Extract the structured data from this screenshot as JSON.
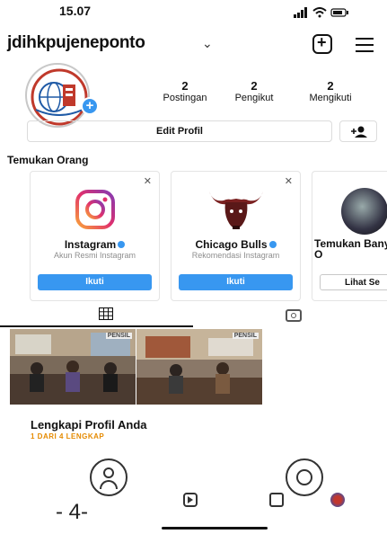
{
  "status_bar": {
    "time": "15.07"
  },
  "header": {
    "username": "jdihkpujeneponto",
    "chevron": "⌄"
  },
  "stats": [
    {
      "value": "2",
      "label": "Postingan"
    },
    {
      "value": "2",
      "label": "Pengikut"
    },
    {
      "value": "2",
      "label": "Mengikuti"
    }
  ],
  "edit_profile_label": "Edit Profil",
  "discover": {
    "title": "Temukan Orang",
    "cards": [
      {
        "name": "Instagram",
        "subtitle": "Akun Resmi Instagram",
        "button": "Ikuti"
      },
      {
        "name": "Chicago Bulls",
        "subtitle": "Rekomendasi Instagram",
        "button": "Ikuti"
      },
      {
        "name": "Temukan Banyak O",
        "button": "Lihat Se"
      }
    ]
  },
  "complete_profile": {
    "title": "Lengkapi Profil Anda",
    "subtitle": "1 DARI 4 LENGKAP"
  },
  "footer": {
    "page_number": "- 4-"
  },
  "colors": {
    "accent": "#3897f0",
    "progress": "#e58a00"
  }
}
